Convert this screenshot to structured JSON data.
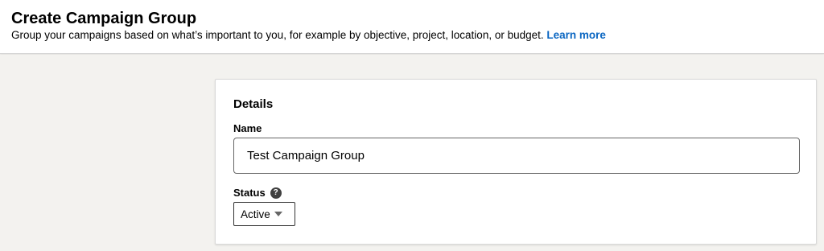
{
  "header": {
    "title": "Create Campaign Group",
    "subtitle": "Group your campaigns based on what’s important to you, for example by objective, project, location, or budget.",
    "learn_more": "Learn more"
  },
  "details": {
    "title": "Details",
    "name_label": "Name",
    "name_value": "Test Campaign Group",
    "status_label": "Status",
    "help_icon": "?",
    "status_value": "Active"
  },
  "icons": {
    "help": "help-icon",
    "caret": "caret-down-icon"
  },
  "colors": {
    "link": "#0a66c2",
    "background": "#f3f2ef",
    "card": "#ffffff"
  }
}
